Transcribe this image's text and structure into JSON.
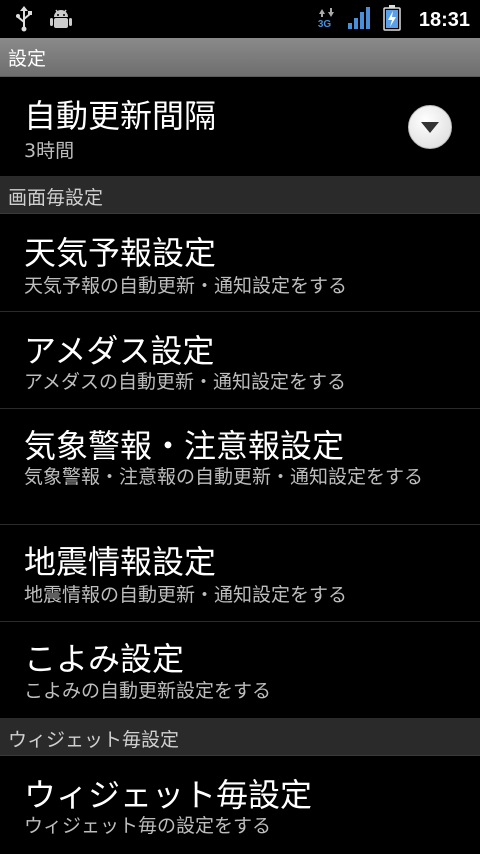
{
  "status_bar": {
    "time": "18:31",
    "network": "3G"
  },
  "title_bar": {
    "title": "設定"
  },
  "auto_update": {
    "title": "自動更新間隔",
    "value": "3時間"
  },
  "category_screen": {
    "label": "画面毎設定"
  },
  "screen_items": [
    {
      "title": "天気予報設定",
      "summary": "天気予報の自動更新・通知設定をする"
    },
    {
      "title": "アメダス設定",
      "summary": "アメダスの自動更新・通知設定をする"
    },
    {
      "title": "気象警報・注意報設定",
      "summary": "気象警報・注意報の自動更新・通知設定をする"
    },
    {
      "title": "地震情報設定",
      "summary": "地震情報の自動更新・通知設定をする"
    },
    {
      "title": "こよみ設定",
      "summary": "こよみの自動更新設定をする"
    }
  ],
  "category_widget": {
    "label": "ウィジェット毎設定"
  },
  "widget_item": {
    "title": "ウィジェット毎設定",
    "summary": "ウィジェット毎の設定をする"
  },
  "colors": {
    "background": "#000000",
    "title_bar": "#7a7a7a",
    "category": "#2a2a2a",
    "summary_text": "#bdbdbd",
    "signal": "#4a90d9",
    "battery_fill": "#5aa0e8"
  }
}
